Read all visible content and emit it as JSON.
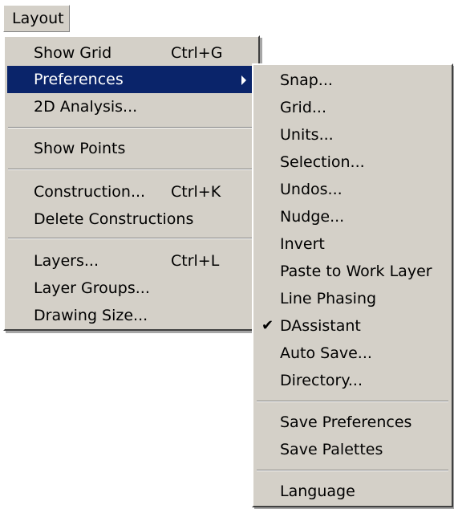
{
  "menubar": {
    "layout_label": "Layout"
  },
  "main_menu": {
    "show_grid": {
      "label": "Show Grid",
      "shortcut": "Ctrl+G"
    },
    "preferences": {
      "label": "Preferences"
    },
    "analysis_2d": {
      "label": "2D Analysis..."
    },
    "show_points": {
      "label": "Show Points"
    },
    "construction": {
      "label": "Construction...",
      "shortcut": "Ctrl+K"
    },
    "delete_constructions": {
      "label": "Delete Constructions"
    },
    "layers": {
      "label": "Layers...",
      "shortcut": "Ctrl+L"
    },
    "layer_groups": {
      "label": "Layer Groups..."
    },
    "drawing_size": {
      "label": "Drawing Size..."
    }
  },
  "preferences_submenu": {
    "snap": "Snap...",
    "grid": "Grid...",
    "units": "Units...",
    "selection": "Selection...",
    "undos": "Undos...",
    "nudge": "Nudge...",
    "invert": "Invert",
    "paste_to_work_layer": "Paste to Work Layer",
    "line_phasing": "Line Phasing",
    "dassistant": {
      "label": "DAssistant",
      "checked": true,
      "check_glyph": "✔"
    },
    "auto_save": "Auto Save...",
    "directory": "Directory...",
    "save_preferences": "Save Preferences",
    "save_palettes": "Save Palettes",
    "language": "Language"
  },
  "colors": {
    "menu_background": "#d4d0c8",
    "highlight": "#0a246a",
    "highlight_text": "#ffffff"
  }
}
